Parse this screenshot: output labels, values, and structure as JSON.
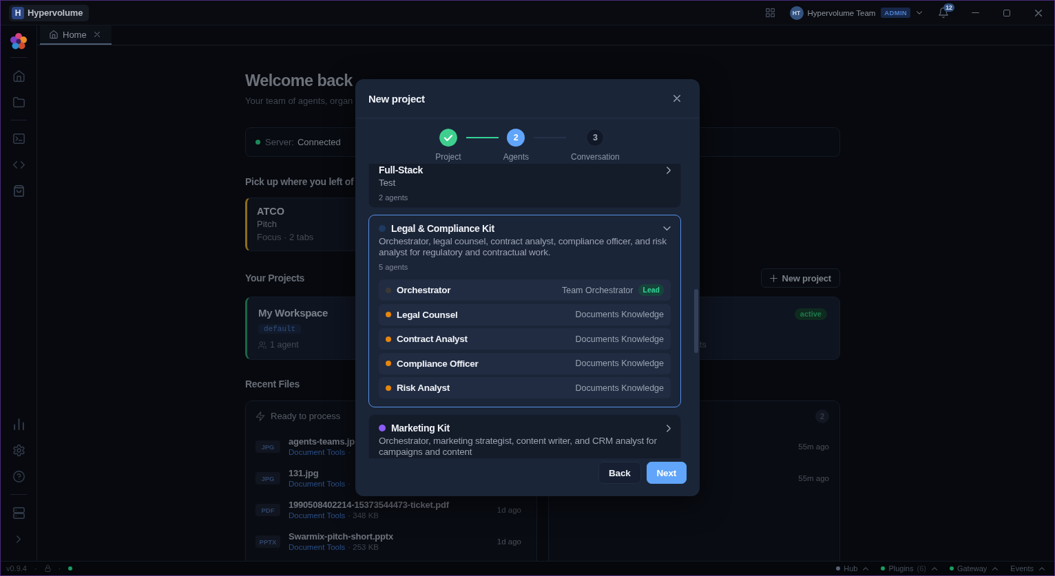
{
  "window": {
    "app_initial": "H",
    "app_name": "Hypervolume",
    "user": {
      "initials": "HT",
      "name": "Hypervolume Team",
      "role": "ADMIN"
    },
    "notifications": "12"
  },
  "tabs": [
    {
      "label": "Home",
      "selected": true
    }
  ],
  "home": {
    "heading": "Welcome back",
    "subtitle": "Your team of agents, organ",
    "server": {
      "label": "Server:",
      "value": "Connected",
      "connected": true
    },
    "resume": {
      "heading": "Pick up where you left of",
      "items": [
        {
          "title": "ATCO",
          "subtitle": "Pitch",
          "meta": "Focus · 2 tabs"
        }
      ]
    },
    "projects": {
      "heading": "Your Projects",
      "new_button": "New project",
      "items": [
        {
          "name": "My Workspace",
          "tag": "default",
          "agents": "1 agent"
        },
        {
          "status": "active",
          "agents": "ts"
        }
      ]
    },
    "recent_files": {
      "heading": "Recent Files",
      "queue": {
        "title": "Ready to process",
        "files": [
          {
            "type": "JPG",
            "name": "agents-teams.jp",
            "source": "Document Tools",
            "detail": "·"
          },
          {
            "type": "JPG",
            "name": "131.jpg",
            "source": "Document Tools",
            "detail": "·"
          },
          {
            "type": "PDF",
            "name": "1990508402214-15373544473-ticket.pdf",
            "source": "Document Tools",
            "detail": "· 348 KB",
            "time": "1d ago"
          },
          {
            "type": "PPTX",
            "name": "Swarmix-pitch-short.pptx",
            "source": "Document Tools",
            "detail": "· 253 KB",
            "time": "1d ago"
          }
        ]
      },
      "processed": {
        "count": "2",
        "files": [
          {
            "time": "55m ago"
          },
          {
            "time": "55m ago"
          }
        ]
      }
    }
  },
  "dialog": {
    "title": "New project",
    "steps": [
      {
        "label": "Project",
        "completed": true,
        "selected": false
      },
      {
        "label": "Agents",
        "number": "2",
        "completed": false,
        "selected": true
      },
      {
        "label": "Conversation",
        "number": "3",
        "completed": false,
        "selected": false
      }
    ],
    "kits": [
      {
        "name": "Full-Stack",
        "description": "Test",
        "agents": "2 agents",
        "selected": false,
        "expanded": false
      },
      {
        "name": "Legal & Compliance Kit",
        "color": "#1e3a5f",
        "description": "Orchestrator, legal counsel, contract analyst, compliance officer, and risk analyst for regulatory and contractual work.",
        "agents": "5 agents",
        "selected": true,
        "expanded": true,
        "members": [
          {
            "name": "Orchestrator",
            "role": "Team Orchestrator",
            "badge": "Lead",
            "color": "#3b3935"
          },
          {
            "name": "Legal Counsel",
            "role": "Documents Knowledge",
            "color": "#e8850c"
          },
          {
            "name": "Contract Analyst",
            "role": "Documents Knowledge",
            "color": "#e8850c"
          },
          {
            "name": "Compliance Officer",
            "role": "Documents Knowledge",
            "color": "#e8850c"
          },
          {
            "name": "Risk Analyst",
            "role": "Documents Knowledge",
            "color": "#e8850c"
          }
        ]
      },
      {
        "name": "Marketing Kit",
        "color": "#8b5cf6",
        "description": "Orchestrator, marketing strategist, content writer, and CRM analyst for campaigns and content",
        "selected": false,
        "expanded": false
      }
    ],
    "buttons": [
      {
        "label": "Back",
        "kind": "secondary"
      },
      {
        "label": "Next",
        "kind": "primary"
      }
    ]
  },
  "status_bar": {
    "left": [
      {
        "kind": "version",
        "text": "v0.9.4"
      },
      {
        "kind": "separator",
        "text": "·"
      },
      {
        "kind": "lock"
      },
      {
        "kind": "separator",
        "text": "·"
      },
      {
        "kind": "dot",
        "color": "#1c9a5e"
      }
    ],
    "services": [
      {
        "name": "Hub",
        "color": "#566072"
      },
      {
        "name": "Plugins",
        "count": "(6)",
        "color": "#1c9a5e"
      },
      {
        "name": "Gateway",
        "color": "#1c9a5e"
      },
      {
        "name": "Events"
      }
    ]
  }
}
